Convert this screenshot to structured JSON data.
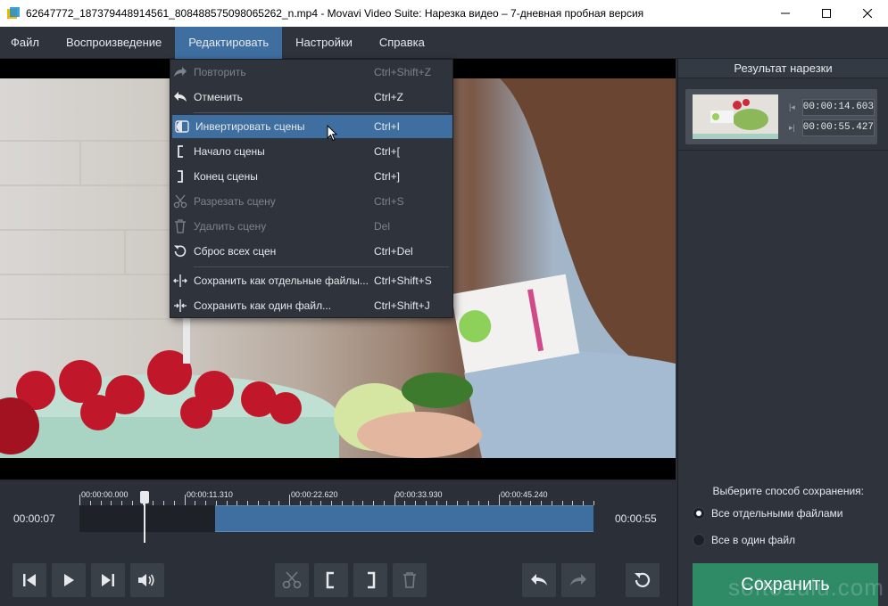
{
  "window": {
    "title": "62647772_187379448914561_808488575098065262_n.mp4 - Movavi Video Suite: Нарезка видео – 7-дневная пробная версия",
    "icon": "movavi-app-icon",
    "controls": [
      "minimize-icon",
      "maximize-icon",
      "close-icon"
    ]
  },
  "menubar": {
    "items": [
      {
        "label": "Файл"
      },
      {
        "label": "Воспроизведение"
      },
      {
        "label": "Редактировать",
        "active": true
      },
      {
        "label": "Настройки"
      },
      {
        "label": "Справка"
      }
    ]
  },
  "edit_menu": {
    "items": [
      {
        "label": "Повторить",
        "shortcut": "Ctrl+Shift+Z",
        "icon": "redo-icon",
        "enabled": false
      },
      {
        "label": "Отменить",
        "shortcut": "Ctrl+Z",
        "icon": "undo-icon",
        "enabled": true
      },
      {
        "label": "Инвертировать сцены",
        "shortcut": "Ctrl+I",
        "icon": "invert-scenes-icon",
        "enabled": true,
        "highlighted": true
      },
      {
        "label": "Начало сцены",
        "shortcut": "Ctrl+[",
        "icon": "scene-start-icon",
        "enabled": true
      },
      {
        "label": "Конец сцены",
        "shortcut": "Ctrl+]",
        "icon": "scene-end-icon",
        "enabled": true
      },
      {
        "label": "Разрезать сцену",
        "shortcut": "Ctrl+S",
        "icon": "scissors-icon",
        "enabled": false
      },
      {
        "label": "Удалить сцену",
        "shortcut": "Del",
        "icon": "trash-icon",
        "enabled": false
      },
      {
        "label": "Сброс всех сцен",
        "shortcut": "Ctrl+Del",
        "icon": "reset-icon",
        "enabled": true
      },
      {
        "label": "Сохранить как отдельные файлы...",
        "shortcut": "Ctrl+Shift+S",
        "icon": "save-separate-icon",
        "enabled": true
      },
      {
        "label": "Сохранить как один файл...",
        "shortcut": "Ctrl+Shift+J",
        "icon": "save-merged-icon",
        "enabled": true
      }
    ]
  },
  "result_panel": {
    "title": "Результат нарезки",
    "clip": {
      "start_time": "00:00:14.603",
      "end_time": "00:00:55.427"
    }
  },
  "timeline": {
    "current_time": "00:00:07",
    "total_time": "00:00:55",
    "tick_labels": [
      "00:00:00.000",
      "00:00:11.310",
      "00:00:22.620",
      "00:00:33.930",
      "00:00:45.240"
    ],
    "playhead_seconds": 7,
    "selection_seconds": [
      14.603,
      55.427
    ],
    "duration_seconds": 55.427
  },
  "save_options": {
    "label": "Выберите способ сохранения:",
    "options": [
      {
        "label": "Все отдельными файлами",
        "selected": true
      },
      {
        "label": "Все в один файл",
        "selected": false
      }
    ],
    "button": "Сохранить"
  },
  "watermark": "softo1ulu.com",
  "colors": {
    "accent": "#3f6fa0",
    "save_button": "#2e8b66",
    "panel": "#2f343c",
    "background": "#2b3038"
  }
}
